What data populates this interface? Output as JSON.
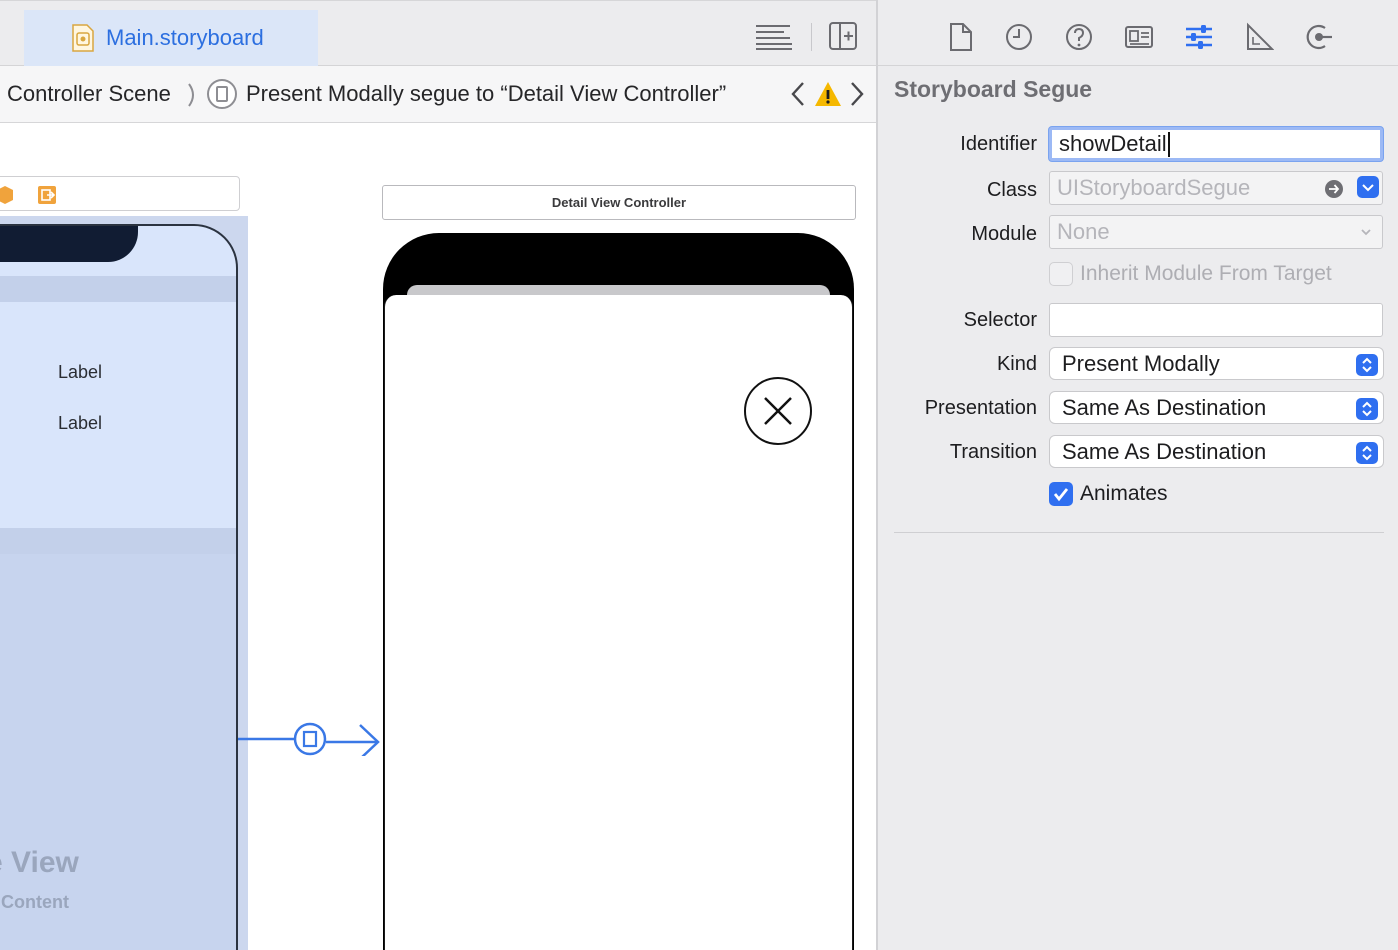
{
  "editor": {
    "tab_label": "Main.storyboard",
    "breadcrumb": {
      "scene": "Controller Scene",
      "segue": "Present Modally segue to “Detail View Controller”"
    }
  },
  "canvas": {
    "left_scene": {
      "labels": [
        "Label",
        "Label"
      ],
      "view_title": "e View",
      "view_subtitle": "e Content"
    },
    "detail_scene": {
      "title": "Detail View Controller"
    }
  },
  "inspector": {
    "section_title": "Storyboard Segue",
    "fields": {
      "identifier": {
        "label": "Identifier",
        "value": "showDetail"
      },
      "class": {
        "label": "Class",
        "placeholder": "UIStoryboardSegue"
      },
      "module": {
        "label": "Module",
        "placeholder": "None"
      },
      "inherit_module": {
        "label": "Inherit Module From Target",
        "checked": false
      },
      "selector": {
        "label": "Selector",
        "value": ""
      },
      "kind": {
        "label": "Kind",
        "value": "Present Modally"
      },
      "presentation": {
        "label": "Presentation",
        "value": "Same As Destination"
      },
      "transition": {
        "label": "Transition",
        "value": "Same As Destination"
      },
      "animates": {
        "label": "Animates",
        "checked": true
      }
    }
  },
  "colors": {
    "accent": "#2f6ff0",
    "tab_active_bg": "#dbe6f8",
    "warning": "#f5b800"
  },
  "icons": {
    "inspector_tabs": [
      "file-icon",
      "history-icon",
      "help-icon",
      "identity-icon",
      "attributes-icon",
      "size-icon",
      "connections-icon"
    ]
  }
}
